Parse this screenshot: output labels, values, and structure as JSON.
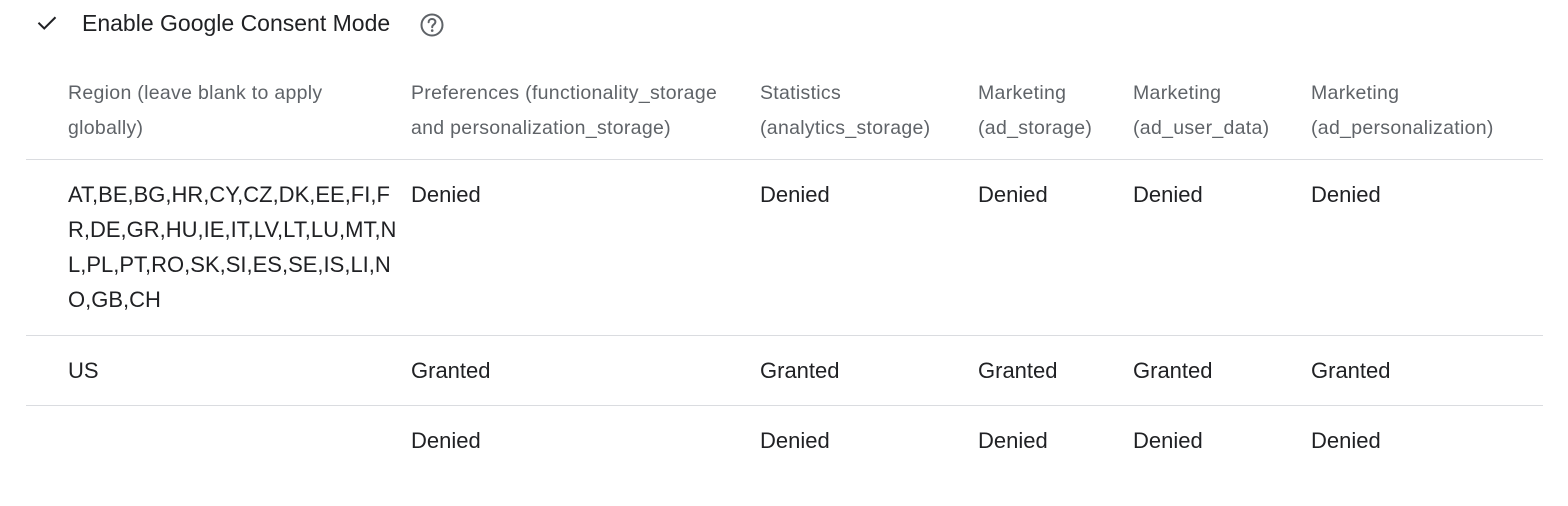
{
  "setting": {
    "label": "Enable Google Consent Mode",
    "checked": true,
    "icons": {
      "check": "check-icon",
      "help": "help-circle-icon"
    }
  },
  "table": {
    "headers": [
      "Region (leave blank to apply globally)",
      "Preferences (functionality_storage and personalization_storage)",
      "Statistics (analytics_storage)",
      "Marketing (ad_storage)",
      "Marketing (ad_user_data)",
      "Marketing (ad_personalization)"
    ],
    "header_lines": [
      [
        "Region (leave blank to apply",
        "globally)"
      ],
      [
        "Preferences (functionality_storage",
        "and personalization_storage)"
      ],
      [
        "Statistics",
        "(analytics_storage)"
      ],
      [
        "Marketing",
        "(ad_storage)"
      ],
      [
        "Marketing",
        "(ad_user_data)"
      ],
      [
        "Marketing",
        "(ad_personalization)"
      ]
    ],
    "rows": [
      {
        "region": "AT,BE,BG,HR,CY,CZ,DK,EE,FI,FR,DE,GR,HU,IE,IT,LV,LT,LU,MT,NL,PL,PT,RO,SK,SI,ES,SE,IS,LI,NO,GB,CH",
        "region_lines": [
          "AT,BE,BG,HR,CY,CZ,DK,EE,FI,F",
          "R,DE,GR,HU,IE,IT,LV,LT,LU,MT,N",
          "L,PL,PT,RO,SK,SI,ES,SE,IS,LI,N",
          "O,GB,CH"
        ],
        "preferences": "Denied",
        "statistics": "Denied",
        "ad_storage": "Denied",
        "ad_user_data": "Denied",
        "ad_personalization": "Denied"
      },
      {
        "region": "US",
        "region_lines": [
          "US"
        ],
        "preferences": "Granted",
        "statistics": "Granted",
        "ad_storage": "Granted",
        "ad_user_data": "Granted",
        "ad_personalization": "Granted"
      },
      {
        "region": "",
        "region_lines": [
          ""
        ],
        "preferences": "Denied",
        "statistics": "Denied",
        "ad_storage": "Denied",
        "ad_user_data": "Denied",
        "ad_personalization": "Denied"
      }
    ]
  },
  "colors": {
    "text": "#202124",
    "header_text": "#5f6368",
    "divider": "#dadce0",
    "icon": "#202124",
    "help_icon": "#5f6368"
  }
}
